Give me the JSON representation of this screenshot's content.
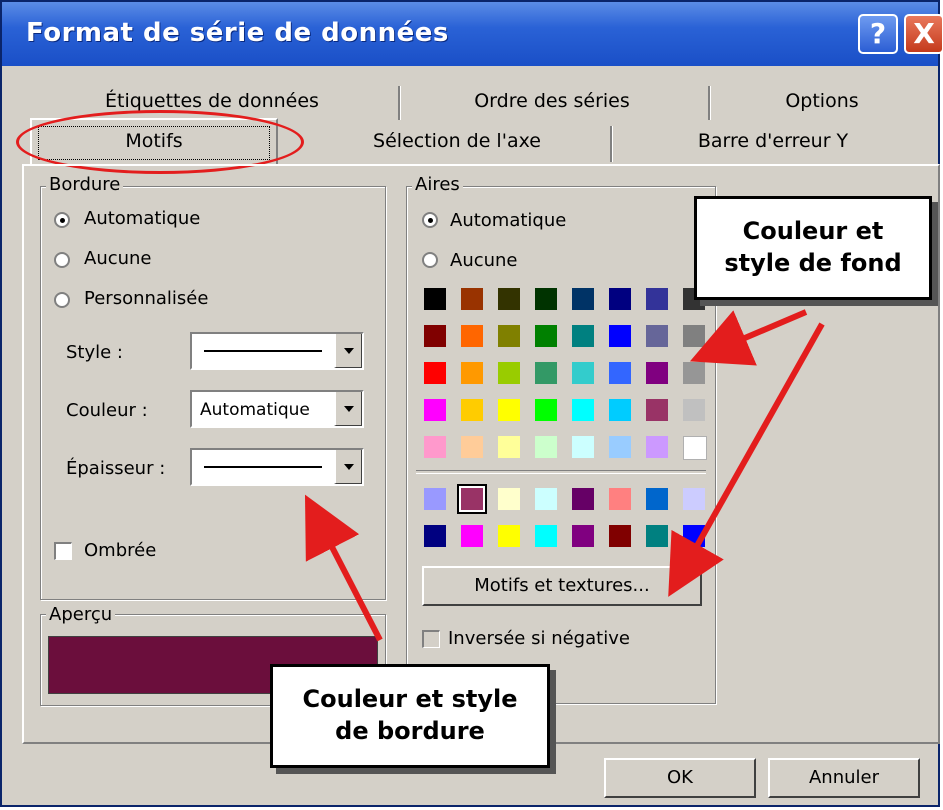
{
  "window": {
    "title": "Format de série de données",
    "help_label": "?",
    "close_label": "X"
  },
  "tabs": {
    "row1": [
      "Étiquettes de données",
      "Ordre des séries",
      "Options"
    ],
    "row2": [
      "Motifs",
      "Sélection de l'axe",
      "Barre d'erreur Y"
    ],
    "active": "Motifs"
  },
  "bordure": {
    "legend": "Bordure",
    "options": [
      "Automatique",
      "Aucune",
      "Personnalisée"
    ],
    "selected": "Automatique",
    "style_label": "Style :",
    "couleur_label": "Couleur :",
    "couleur_value": "Automatique",
    "epaisseur_label": "Épaisseur :",
    "ombree_label": "Ombrée",
    "ombree_checked": false
  },
  "apercu": {
    "legend": "Aperçu",
    "color": "#6b0e3c"
  },
  "aires": {
    "legend": "Aires",
    "options": [
      "Automatique",
      "Aucune"
    ],
    "selected": "Automatique",
    "palette": [
      [
        "#000000",
        "#993300",
        "#333300",
        "#003300",
        "#003366",
        "#000080",
        "#333399",
        "#333333"
      ],
      [
        "#800000",
        "#ff6600",
        "#808000",
        "#008000",
        "#008080",
        "#0000ff",
        "#666699",
        "#808080"
      ],
      [
        "#ff0000",
        "#ff9900",
        "#99cc00",
        "#339966",
        "#33cccc",
        "#3366ff",
        "#800080",
        "#969696"
      ],
      [
        "#ff00ff",
        "#ffcc00",
        "#ffff00",
        "#00ff00",
        "#00ffff",
        "#00ccff",
        "#993366",
        "#c0c0c0"
      ],
      [
        "#ff99cc",
        "#ffcc99",
        "#ffff99",
        "#ccffcc",
        "#ccffff",
        "#99ccff",
        "#cc99ff",
        "#ffffff"
      ]
    ],
    "palette_extra": [
      [
        "#9999ff",
        "#993366",
        "#ffffcc",
        "#ccffff",
        "#660066",
        "#ff8080",
        "#0066cc",
        "#ccccff"
      ],
      [
        "#000080",
        "#ff00ff",
        "#ffff00",
        "#00ffff",
        "#800080",
        "#800000",
        "#008080",
        "#0000ff"
      ]
    ],
    "selected_color": "#993366",
    "motifs_button": "Motifs et textures...",
    "inversee_label": "Inversée si négative"
  },
  "footer": {
    "ok_label": "OK",
    "annuler_label": "Annuler"
  },
  "annotations": {
    "fond_line1": "Couleur et",
    "fond_line2": "style de fond",
    "bordure_line1": "Couleur et style",
    "bordure_line2": "de bordure",
    "arrow_color": "#e31d1d"
  }
}
